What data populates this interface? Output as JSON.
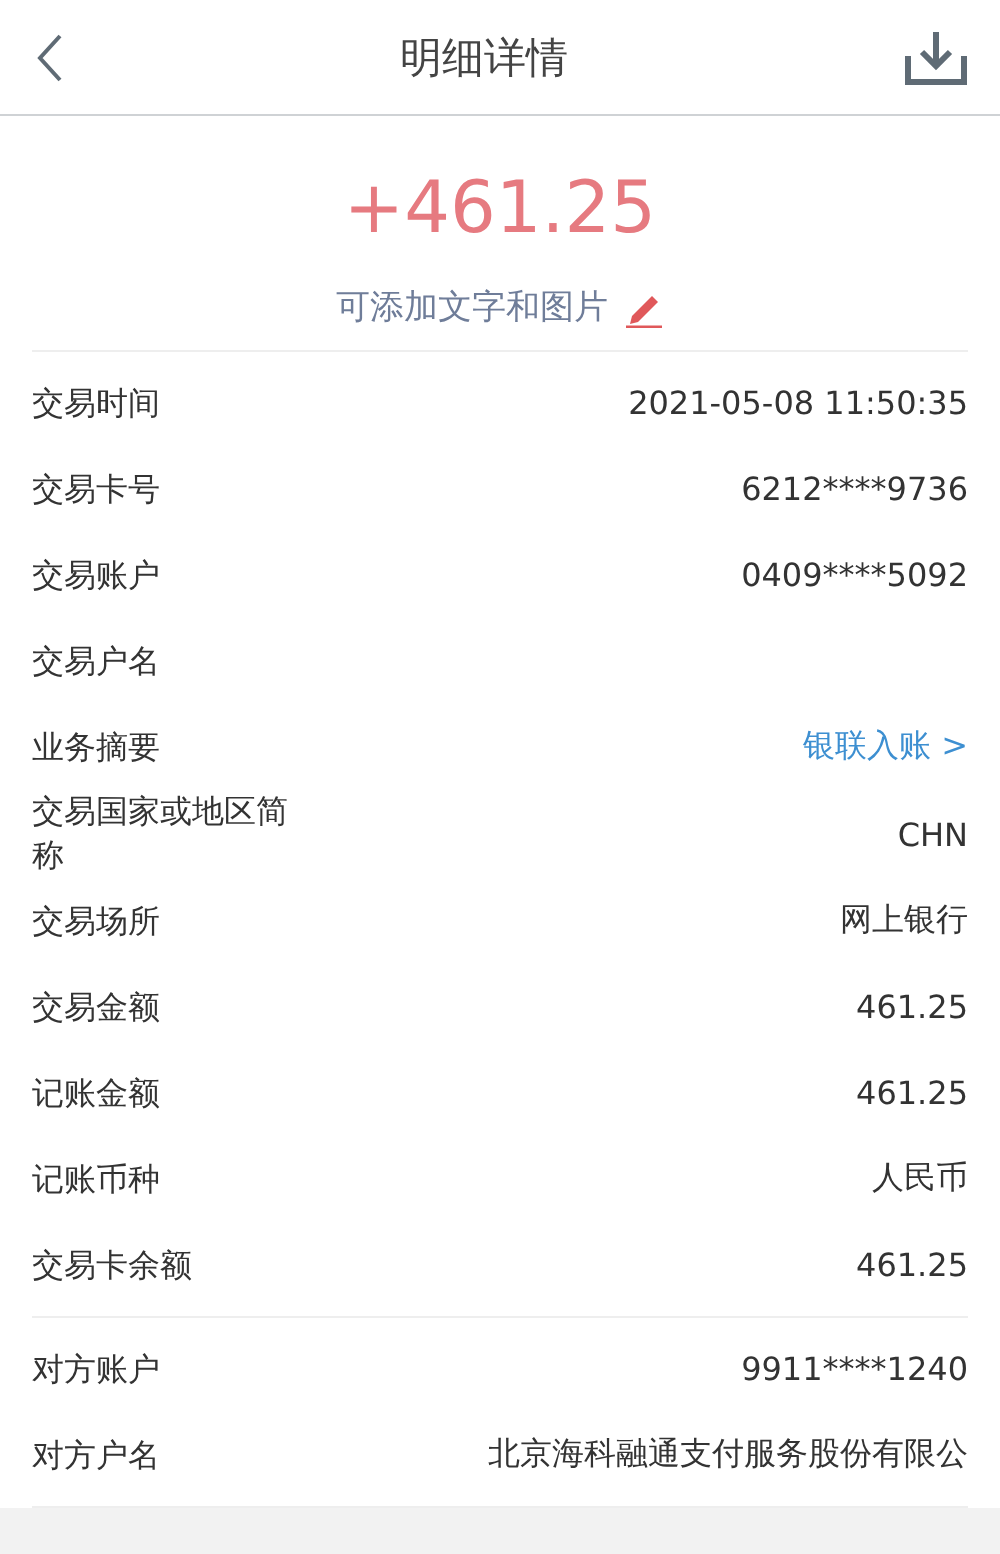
{
  "header": {
    "title": "明细详情"
  },
  "amount": "+461.25",
  "note": "可添加文字和图片",
  "details": [
    {
      "label": "交易时间",
      "value": "2021-05-08 11:50:35",
      "link": false
    },
    {
      "label": "交易卡号",
      "value": "6212****9736",
      "link": false
    },
    {
      "label": "交易账户",
      "value": "0409****5092",
      "link": false
    },
    {
      "label": "交易户名"
    },
    {
      "label": "业务摘要",
      "value": "银联入账 >",
      "link": true
    },
    {
      "label": "交易国家或地区简称",
      "value": "CHN",
      "link": false
    },
    {
      "label": "交易场所",
      "value": "网上银行",
      "link": false
    },
    {
      "label": "交易金额",
      "value": "461.25",
      "link": false
    },
    {
      "label": "记账金额",
      "value": "461.25",
      "link": false
    },
    {
      "label": "记账币种",
      "value": "人民币",
      "link": false
    },
    {
      "label": "交易卡余额",
      "value": "461.25",
      "link": false
    }
  ],
  "counterparty": [
    {
      "label": "对方账户",
      "value": "9911****1240",
      "link": false
    },
    {
      "label": "对方户名",
      "value": "北京海科融通支付服务股份有限公",
      "link": false
    }
  ]
}
